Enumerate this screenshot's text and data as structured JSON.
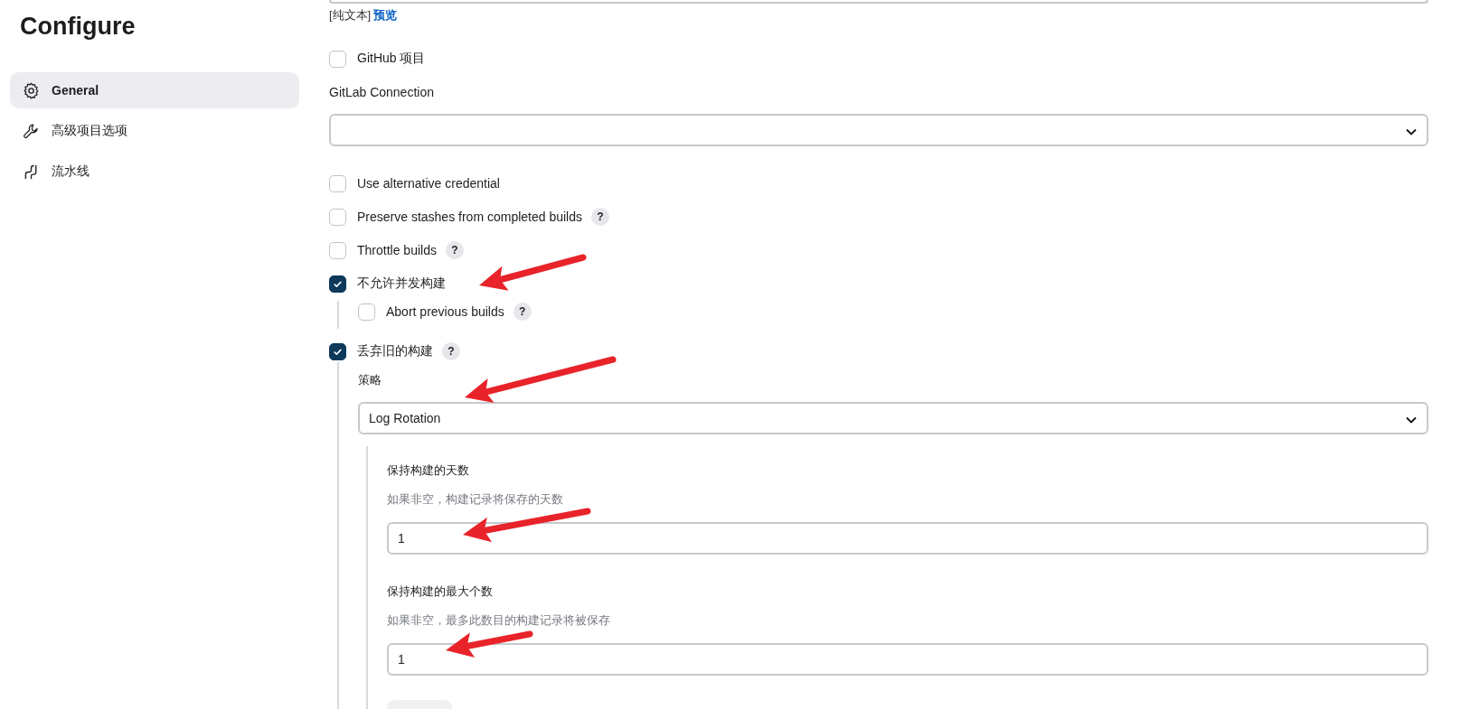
{
  "sidebar": {
    "title": "Configure",
    "items": [
      {
        "label": "General",
        "selected": true
      },
      {
        "label": "高级项目选项",
        "selected": false
      },
      {
        "label": "流水线",
        "selected": false
      }
    ]
  },
  "description": {
    "format": "[纯文本]",
    "preview_link": "预览"
  },
  "options": [
    {
      "kind": "checkbox",
      "label": "GitHub 项目",
      "checked": false
    },
    {
      "kind": "select",
      "label": "GitLab Connection"
    },
    {
      "kind": "checkbox",
      "label": "Use alternative credential",
      "checked": false
    },
    {
      "kind": "checkbox",
      "label": "Preserve stashes from completed builds",
      "checked": false,
      "help": "?"
    },
    {
      "kind": "checkbox",
      "label": "Throttle builds",
      "checked": false,
      "help": "?"
    },
    {
      "kind": "checkbox",
      "label": "不允许并发构建",
      "checked": true,
      "children": [
        {
          "kind": "checkbox",
          "label": "Abort previous builds",
          "checked": false,
          "help": "?"
        }
      ]
    },
    {
      "kind": "checkbox",
      "label": "丢弃旧的构建",
      "checked": true,
      "help": "?",
      "children": [
        {
          "kind": "select",
          "label": "策略",
          "value": "Log Rotation",
          "children": [
            {
              "kind": "number",
              "label": "保持构建的天数",
              "hint": "如果非空，构建记录将保存的天数",
              "value": "1"
            },
            {
              "kind": "number",
              "label": "保持构建的最大个数",
              "hint": "如果非空，最多此数目的构建记录将被保存",
              "value": "1"
            }
          ]
        }
      ]
    }
  ]
}
